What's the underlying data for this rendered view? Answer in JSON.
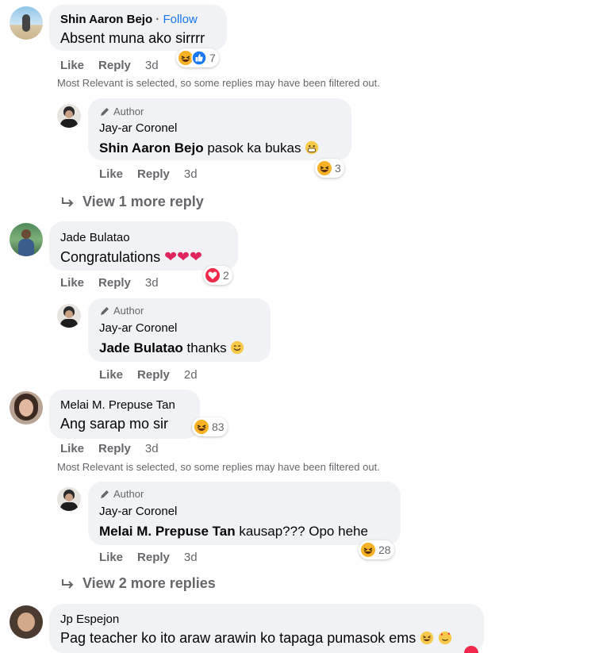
{
  "comments": [
    {
      "author": "Shin Aaron Bejo",
      "follow_sep": " · ",
      "follow": "Follow",
      "text": "Absent muna ako sirrrr",
      "actions": {
        "like": "Like",
        "reply": "Reply",
        "time": "3d"
      },
      "reaction_count": "7",
      "filter_note": "Most Relevant is selected, so some replies may have been filtered out.",
      "reply": {
        "badge": "Author",
        "author": "Jay-ar Coronel",
        "mention": "Shin Aaron Bejo",
        "text": " pasok ka bukas",
        "actions": {
          "like": "Like",
          "reply": "Reply",
          "time": "3d"
        },
        "reaction_count": "3"
      },
      "view_more": "View 1 more reply"
    },
    {
      "author": "Jade Bulatao",
      "text": "Congratulations",
      "actions": {
        "like": "Like",
        "reply": "Reply",
        "time": "3d"
      },
      "reaction_count": "2",
      "reply": {
        "badge": "Author",
        "author": "Jay-ar Coronel",
        "mention": "Jade Bulatao",
        "text": " thanks",
        "actions": {
          "like": "Like",
          "reply": "Reply",
          "time": "2d"
        }
      }
    },
    {
      "author": "Melai M. Prepuse Tan",
      "text": "Ang sarap mo sir",
      "actions": {
        "like": "Like",
        "reply": "Reply",
        "time": "3d"
      },
      "reaction_count": "83",
      "filter_note": "Most Relevant is selected, so some replies may have been filtered out.",
      "reply": {
        "badge": "Author",
        "author": "Jay-ar Coronel",
        "mention": "Melai M. Prepuse Tan",
        "text": " kausap??? Opo hehe",
        "actions": {
          "like": "Like",
          "reply": "Reply",
          "time": "3d"
        },
        "reaction_count": "28"
      },
      "view_more": "View 2 more replies"
    },
    {
      "author": "Jp Espejon",
      "text": "Pag teacher ko ito araw arawin ko tapaga pumasok ems"
    }
  ],
  "colors": {
    "bubble": "#f0f2f5",
    "secondary_text": "#65676b",
    "link": "#1877f2",
    "heart": "#f02849",
    "haha": "#f7b125",
    "like": "#1877f2"
  },
  "icons": {
    "haha": "haha-reaction-icon",
    "like": "like-reaction-icon",
    "love": "love-reaction-icon",
    "pencil": "pencil-icon",
    "reply_arrow": "reply-arrow-icon",
    "heart": "red-heart-emoji",
    "smile": "smiling-emoji",
    "grin": "grinning-emoji"
  }
}
